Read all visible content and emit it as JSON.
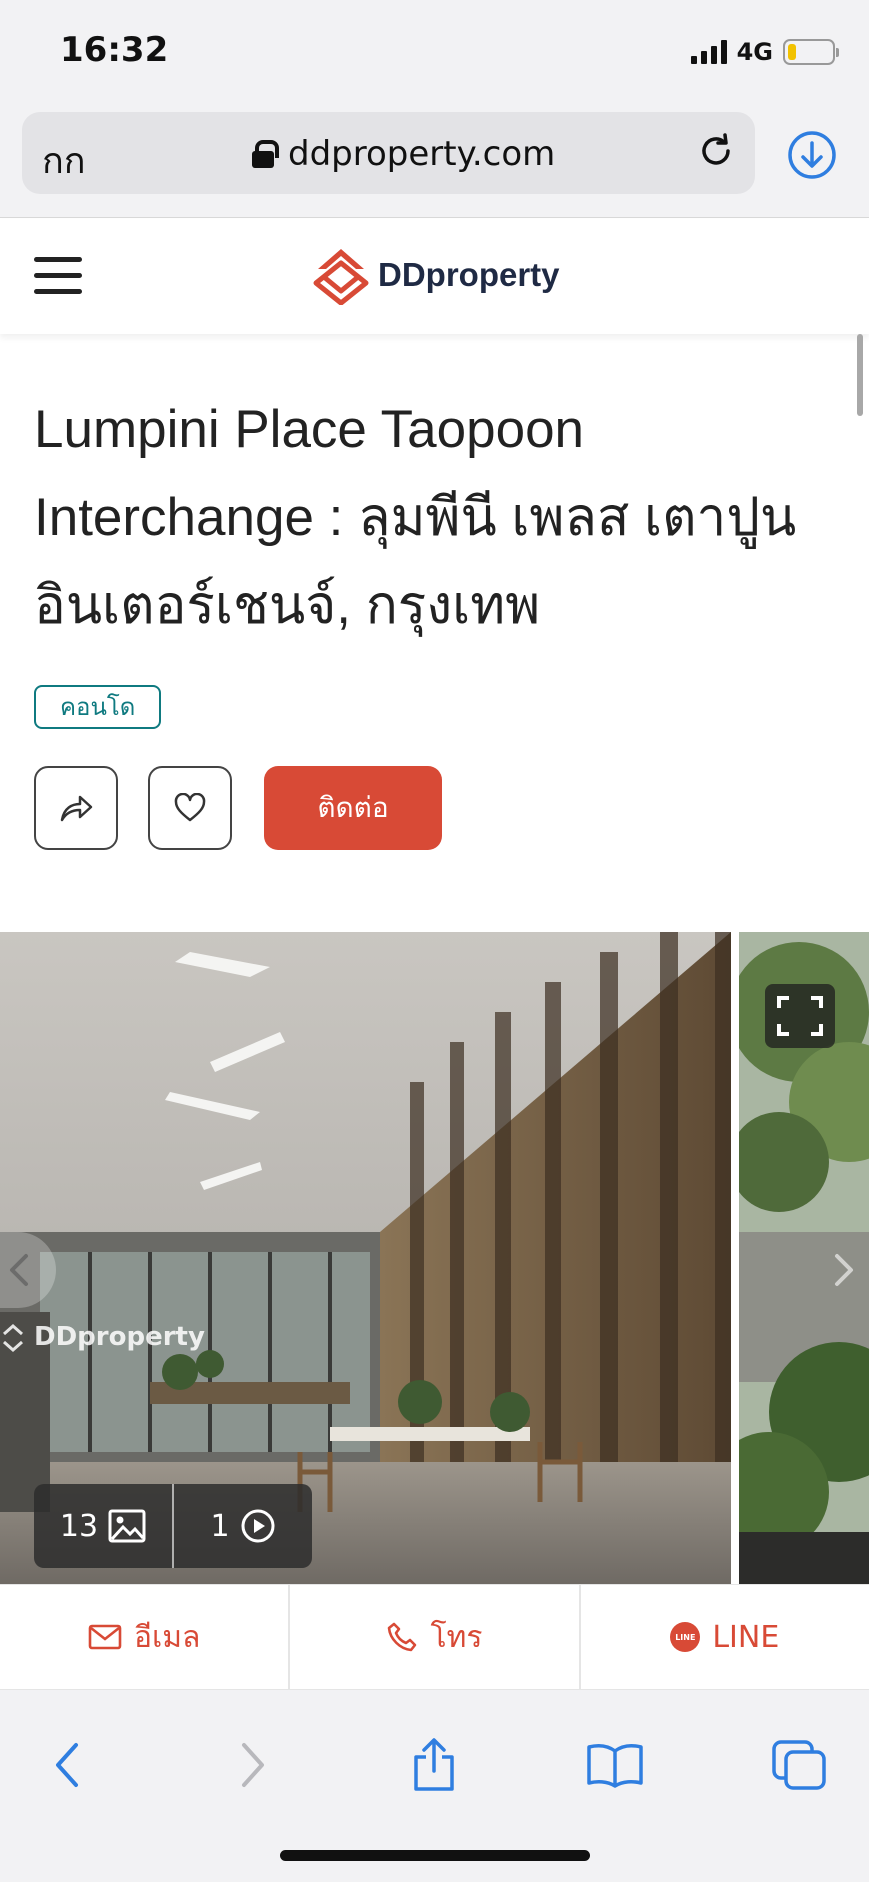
{
  "status_bar": {
    "time": "16:32",
    "network": "4G"
  },
  "browser": {
    "text_size_label": "กก",
    "url": "ddproperty.com"
  },
  "site": {
    "brand": "DDproperty"
  },
  "listing": {
    "title": "Lumpini Place Taopoon Interchange : ลุมพีนี เพลส เตาปูน อินเตอร์เชนจ์, กรุงเทพ",
    "type_tag": "คอนโด",
    "contact_label": "ติดต่อ"
  },
  "gallery": {
    "watermark": "DDproperty",
    "photo_count": "13",
    "video_count": "1"
  },
  "actions": {
    "email_label": "อีเมล",
    "call_label": "โทร",
    "line_label": "LINE",
    "line_badge": "LINE"
  },
  "colors": {
    "brand_red": "#d84a36",
    "teal": "#0f7a80",
    "safari_blue": "#2f7ee0"
  }
}
